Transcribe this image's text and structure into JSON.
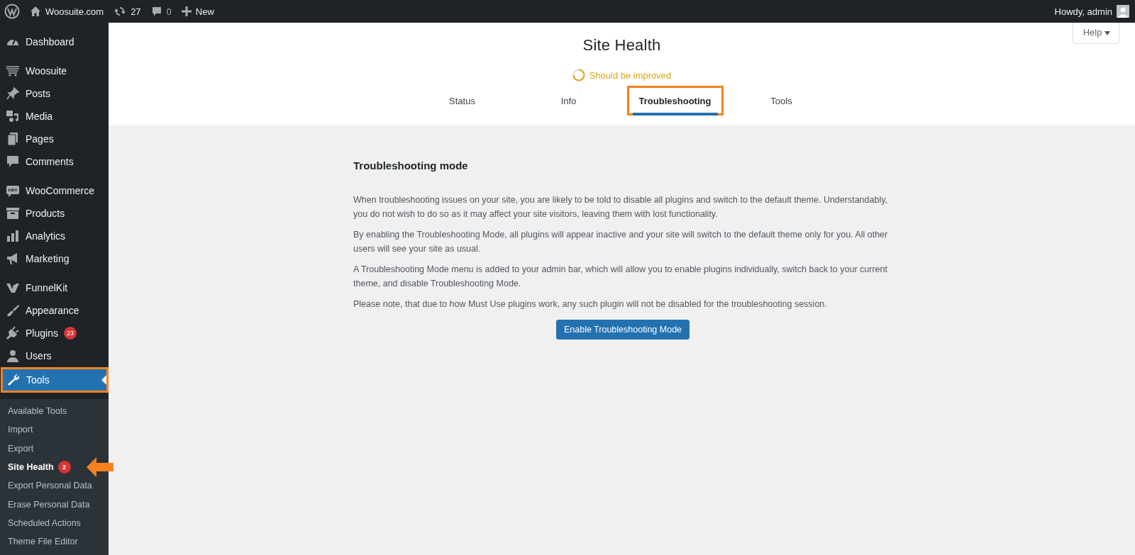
{
  "admin_bar": {
    "site": "Woosuite.com",
    "updates": "27",
    "comments": "0",
    "new": "New",
    "greeting": "Howdy, admin"
  },
  "sidebar": {
    "groups": [
      [
        {
          "label": "Dashboard",
          "current": false,
          "highlighted": false
        }
      ],
      [
        {
          "label": "Woosuite",
          "current": false,
          "highlighted": false
        },
        {
          "label": "Posts",
          "current": false,
          "highlighted": false
        },
        {
          "label": "Media",
          "current": false,
          "highlighted": false
        },
        {
          "label": "Pages",
          "current": false,
          "highlighted": false
        },
        {
          "label": "Comments",
          "current": false,
          "highlighted": false
        }
      ],
      [
        {
          "label": "WooCommerce",
          "current": false,
          "highlighted": false
        },
        {
          "label": "Products",
          "current": false,
          "highlighted": false
        },
        {
          "label": "Analytics",
          "current": false,
          "highlighted": false
        },
        {
          "label": "Marketing",
          "current": false,
          "highlighted": false
        }
      ],
      [
        {
          "label": "FunnelKit",
          "current": false,
          "highlighted": false
        },
        {
          "label": "Appearance",
          "current": false,
          "highlighted": false
        },
        {
          "label": "Plugins",
          "badge": "23",
          "current": false,
          "highlighted": false
        },
        {
          "label": "Users",
          "current": false,
          "highlighted": false
        },
        {
          "label": "Tools",
          "current": true,
          "highlighted": true
        }
      ]
    ],
    "submenu": [
      {
        "label": "Available Tools",
        "selected": false,
        "pointed": false
      },
      {
        "label": "Import",
        "selected": false,
        "pointed": false
      },
      {
        "label": "Export",
        "selected": false,
        "pointed": false
      },
      {
        "label": "Site Health",
        "badge": "2",
        "selected": true,
        "pointed": true
      },
      {
        "label": "Export Personal Data",
        "selected": false,
        "pointed": false
      },
      {
        "label": "Erase Personal Data",
        "selected": false,
        "pointed": false
      },
      {
        "label": "Scheduled Actions",
        "selected": false,
        "pointed": false
      },
      {
        "label": "Theme File Editor",
        "selected": false,
        "pointed": false
      }
    ]
  },
  "page": {
    "help": "Help",
    "title": "Site Health",
    "status": "Should be improved",
    "tabs": [
      {
        "label": "Status",
        "selected": false,
        "highlighted": false
      },
      {
        "label": "Info",
        "selected": false,
        "highlighted": false
      },
      {
        "label": "Troubleshooting",
        "selected": true,
        "highlighted": true
      },
      {
        "label": "Tools",
        "selected": false,
        "highlighted": false
      }
    ]
  },
  "section": {
    "heading": "Troubleshooting mode",
    "paragraphs": [
      "When troubleshooting issues on your site, you are likely to be told to disable all plugins and switch to the default theme. Understandably, you do not wish to do so as it may affect your site visitors, leaving them with lost functionality.",
      "By enabling the Troubleshooting Mode, all plugins will appear inactive and your site will switch to the default theme only for you. All other users will see your site as usual.",
      "A Troubleshooting Mode menu is added to your admin bar, which will allow you to enable plugins individually, switch back to your current theme, and disable Troubleshooting Mode.",
      "Please note, that due to how Must Use plugins work, any such plugin will not be disabled for the troubleshooting session."
    ],
    "button": "Enable Troubleshooting Mode"
  }
}
